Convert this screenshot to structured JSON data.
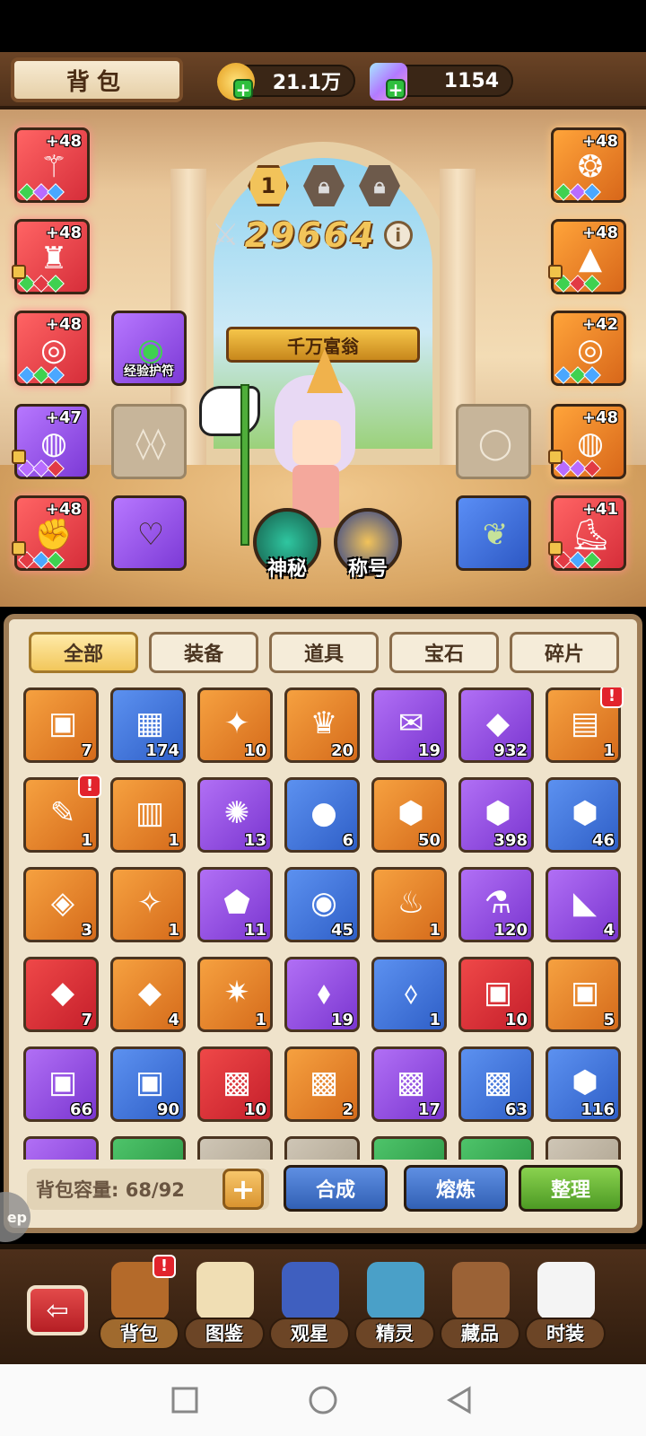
{
  "header": {
    "title": "背包",
    "gold": "21.1万",
    "diamonds": "1154"
  },
  "loadout_tabs": [
    "1",
    "",
    ""
  ],
  "power": "29664",
  "banner_title": "千万富翁",
  "equipment_left": [
    {
      "level": "+48",
      "icon": "staff-icon",
      "rarity": "red"
    },
    {
      "level": "+48",
      "icon": "robe-icon",
      "rarity": "red"
    },
    {
      "level": "+48",
      "icon": "bracelet-icon",
      "rarity": "red"
    },
    {
      "level": "+47",
      "icon": "ring-icon",
      "rarity": "purple"
    },
    {
      "level": "+48",
      "icon": "gauntlet-icon",
      "rarity": "red"
    }
  ],
  "equipment_right": [
    {
      "level": "+48",
      "icon": "amulet-icon",
      "rarity": "orange"
    },
    {
      "level": "+48",
      "icon": "wizard-hat-icon",
      "rarity": "orange"
    },
    {
      "level": "+42",
      "icon": "bracelet-icon",
      "rarity": "orange"
    },
    {
      "level": "+48",
      "icon": "ring-icon",
      "rarity": "orange"
    },
    {
      "level": "+41",
      "icon": "boots-icon",
      "rarity": "red"
    }
  ],
  "inner_slots": {
    "exp_charm": "经验护符"
  },
  "round_buttons": {
    "mystery": "神秘",
    "title": "称号"
  },
  "tabs": [
    "全部",
    "装备",
    "道具",
    "宝石",
    "碎片"
  ],
  "items": [
    {
      "color": "orange",
      "icon": "card-icon",
      "count": "7"
    },
    {
      "color": "blue",
      "icon": "cube-icon",
      "count": "174"
    },
    {
      "color": "orange",
      "icon": "crystal-cluster-icon",
      "count": "10"
    },
    {
      "color": "orange",
      "icon": "trophy-icon",
      "count": "20"
    },
    {
      "color": "purple",
      "icon": "scroll-ticket-icon",
      "count": "19"
    },
    {
      "color": "purple",
      "icon": "ore-icon",
      "count": "932"
    },
    {
      "color": "orange",
      "icon": "treasure-chest-icon",
      "count": "1",
      "alert": "!"
    },
    {
      "color": "orange",
      "icon": "map-scroll-icon",
      "count": "1",
      "alert": "!"
    },
    {
      "color": "orange",
      "icon": "golden-chest-icon",
      "count": "1"
    },
    {
      "color": "purple",
      "icon": "snowflake-gem-icon",
      "count": "13"
    },
    {
      "color": "blue",
      "icon": "green-orb-icon",
      "count": "6"
    },
    {
      "color": "orange",
      "icon": "rank-badge-icon",
      "count": "50"
    },
    {
      "color": "purple",
      "icon": "rank-badge-icon",
      "count": "398"
    },
    {
      "color": "blue",
      "icon": "rank-badge-icon",
      "count": "46"
    },
    {
      "color": "orange",
      "icon": "gold-ore-icon",
      "count": "3"
    },
    {
      "color": "orange",
      "icon": "spark-icon",
      "count": "1"
    },
    {
      "color": "purple",
      "icon": "teal-gem-icon",
      "count": "11"
    },
    {
      "color": "blue",
      "icon": "pearl-icon",
      "count": "45"
    },
    {
      "color": "orange",
      "icon": "potion-bag-icon",
      "count": "1"
    },
    {
      "color": "purple",
      "icon": "potion-icon",
      "count": "120"
    },
    {
      "color": "purple",
      "icon": "cheese-icon",
      "count": "4"
    },
    {
      "color": "red",
      "icon": "red-crystal-icon",
      "count": "7"
    },
    {
      "color": "orange",
      "icon": "amber-crystal-icon",
      "count": "4"
    },
    {
      "color": "orange",
      "icon": "gold-shard-icon",
      "count": "1"
    },
    {
      "color": "purple",
      "icon": "purple-crystal-icon",
      "count": "19"
    },
    {
      "color": "blue",
      "icon": "blue-crystal-icon",
      "count": "1"
    },
    {
      "color": "red",
      "icon": "rune-card-icon",
      "count": "10"
    },
    {
      "color": "orange",
      "icon": "rune-card-icon",
      "count": "5"
    },
    {
      "color": "purple",
      "icon": "rune-card-icon",
      "count": "66"
    },
    {
      "color": "blue",
      "icon": "rune-card-icon",
      "count": "90"
    },
    {
      "color": "red",
      "icon": "wing-card-icon",
      "count": "10"
    },
    {
      "color": "orange",
      "icon": "wing-card-icon",
      "count": "2"
    },
    {
      "color": "purple",
      "icon": "wing-card-icon",
      "count": "17"
    },
    {
      "color": "blue",
      "icon": "wing-card-icon",
      "count": "63"
    },
    {
      "color": "blue",
      "icon": "emerald-icon",
      "count": "116"
    },
    {
      "color": "purple",
      "icon": "partial-item-icon",
      "count": ""
    },
    {
      "color": "green",
      "icon": "partial-item-icon",
      "count": ""
    },
    {
      "color": "grey",
      "icon": "partial-item-icon",
      "count": ""
    },
    {
      "color": "grey",
      "icon": "partial-item-icon",
      "count": ""
    },
    {
      "color": "green",
      "icon": "partial-item-icon",
      "count": ""
    },
    {
      "color": "green",
      "icon": "partial-item-icon",
      "count": ""
    },
    {
      "color": "grey",
      "icon": "partial-item-icon",
      "count": ""
    }
  ],
  "footer": {
    "capacity": "背包容量: 68/92",
    "synthesize": "合成",
    "smelt": "熔炼",
    "organize": "整理"
  },
  "side_pill": "ep",
  "bottom_nav": [
    {
      "label": "背包",
      "icon": "backpack-icon",
      "alert": "!"
    },
    {
      "label": "图鉴",
      "icon": "book-icon"
    },
    {
      "label": "观星",
      "icon": "star-gazing-icon"
    },
    {
      "label": "精灵",
      "icon": "spirit-icon"
    },
    {
      "label": "藏品",
      "icon": "collection-chest-icon"
    },
    {
      "label": "时装",
      "icon": "costume-icon"
    }
  ],
  "colors": {
    "red": "#e23a44",
    "orange": "#e7852a",
    "purple": "#9a55e6",
    "blue": "#4677dc",
    "green": "#3cab52"
  }
}
